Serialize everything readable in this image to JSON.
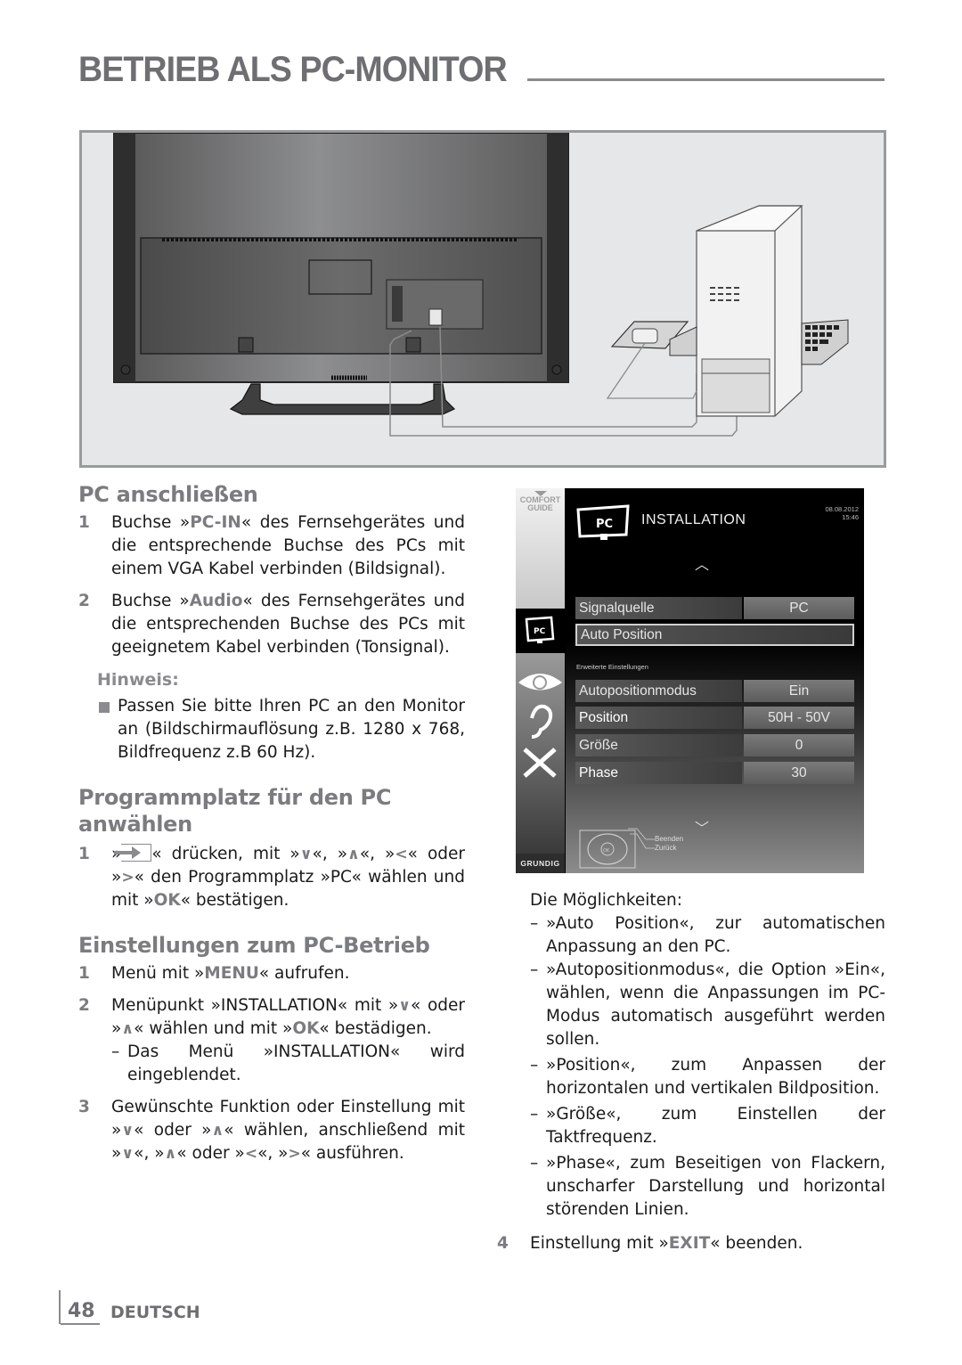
{
  "page": {
    "title": "BETRIEB ALS PC-MONITOR",
    "page_number": "48",
    "language": "DEUTSCH"
  },
  "illustration": {
    "description": "Rear view of TV connected to PC tower with VGA and audio cables; mouse and keyboard beside PC"
  },
  "section_connect": {
    "heading": "PC anschließen",
    "steps": [
      {
        "num": "1",
        "pre": "Buchse »",
        "highlight": "PC-IN",
        "post": "« des Fernsehgerätes und die entsprechende Buchse des PCs mit einem VGA Kabel verbinden (Bildsignal)."
      },
      {
        "num": "2",
        "pre": "Buchse »",
        "highlight": "Audio",
        "post": "« des Fernsehgerätes und die entsprechenden Buchse des PCs mit geeignetem Kabel verbinden (Tonsignal)."
      }
    ],
    "note_label": "Hinweis:",
    "note_text": "Passen Sie bitte Ihren PC an den Monitor an (Bildschirmauflösung z.B. 1280 x 768, Bildfrequenz z.B 60 Hz)."
  },
  "section_program": {
    "heading": "Programmplatz für den PC anwählen",
    "step": {
      "num": "1",
      "t1": "»",
      "icon": "input-source-icon",
      "t2": "« drücken, mit »",
      "k1": "∨",
      "t3": "«, »",
      "k2": "∧",
      "t4": "«, »",
      "k3": "<",
      "t5": "« oder »",
      "k4": ">",
      "t6": "« den Programmplatz »PC« wählen und mit »",
      "k5": "OK",
      "t7": "« bestätigen."
    }
  },
  "section_settings": {
    "heading": "Einstellungen zum PC-Betrieb",
    "step1": {
      "num": "1",
      "pre": "Menü mit »",
      "key": "MENU",
      "post": "« aufrufen."
    },
    "step2": {
      "num": "2",
      "t1": "Menüpunkt »INSTALLATION« mit »",
      "k1": "∨",
      "t2": "« oder »",
      "k2": "∧",
      "t3": "« wählen und mit »",
      "k3": "OK",
      "t4": "« bestädigen.",
      "sub": "Das Menü »INSTALLATION« wird eingeblendet."
    },
    "step3": {
      "num": "3",
      "t1": "Gewünschte Funktion oder Einstellung mit »",
      "k1": "∨",
      "t2": "« oder »",
      "k2": "∧",
      "t3": "« wählen, anschließend mit »",
      "k3": "∨",
      "t4": "«, »",
      "k4": "∧",
      "t5": "« oder »",
      "k5": "<",
      "t6": "«, »",
      "k6": ">",
      "t7": "« ausführen."
    },
    "options_intro": "Die Möglichkeiten:",
    "options": [
      "»Auto Position«, zur automatischen Anpassung an den PC.",
      "»Autopositionmodus«, die Option »Ein«, wählen, wenn die Anpassungen im PC-Modus automatisch ausgeführt werden sollen.",
      "»Position«, zum Anpassen der horizontalen und vertikalen Bildposition.",
      "»Größe«, zum Einstellen der Taktfrequenz.",
      "»Phase«, zum Beseitigen von Flackern, unscharfer Darstellung und horizontal störenden Linien."
    ],
    "step4": {
      "num": "4",
      "pre": "Einstellung mit »",
      "key": "EXIT",
      "post": "« beenden."
    }
  },
  "tv_menu": {
    "comfort_guide": [
      "COMFORT",
      "GUIDE"
    ],
    "title": "INSTALLATION",
    "date": "08.08.2012",
    "time": "15:46",
    "rows_top": [
      {
        "label": "Signalquelle",
        "value": "PC"
      },
      {
        "label": "Auto Position",
        "value": ""
      }
    ],
    "sub_heading": "Erweiterte Einstellungen",
    "rows_advanced": [
      {
        "label": "Autopositionmodus",
        "value": "Ein"
      },
      {
        "label": "Position",
        "value": "50H - 50V"
      },
      {
        "label": "Größe",
        "value": "0"
      },
      {
        "label": "Phase",
        "value": "30"
      }
    ],
    "legend": [
      "Beenden",
      "Zurück"
    ],
    "brand": "GRUNDIG",
    "remote_ok": "OK"
  }
}
